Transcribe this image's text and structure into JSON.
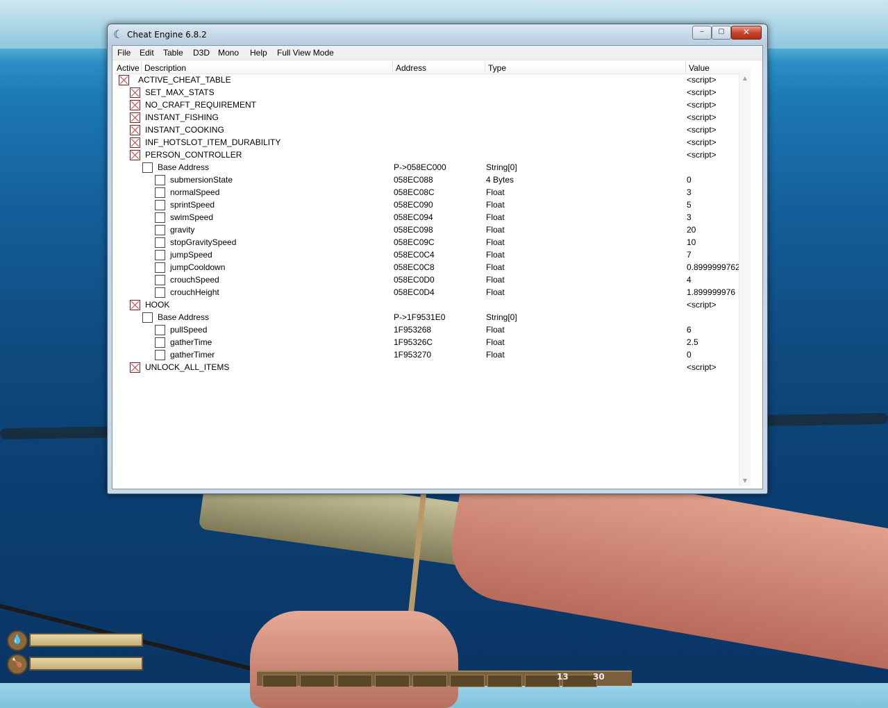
{
  "window": {
    "title": "Cheat Engine 6.8.2",
    "controls": {
      "minimize": "‒",
      "maximize": "▢",
      "close": "✕"
    }
  },
  "menu": [
    "File",
    "Edit",
    "Table",
    "D3D",
    "Mono",
    "Help",
    "Full View Mode"
  ],
  "columns": {
    "active": "Active",
    "description": "Description",
    "address": "Address",
    "type": "Type",
    "value": "Value"
  },
  "rows": [
    {
      "level": 0,
      "checked": true,
      "description": "ACTIVE_CHEAT_TABLE",
      "address": "",
      "type": "",
      "value": "<script>"
    },
    {
      "level": 1,
      "checked": true,
      "description": "SET_MAX_STATS",
      "address": "",
      "type": "",
      "value": "<script>"
    },
    {
      "level": 1,
      "checked": true,
      "description": "NO_CRAFT_REQUIREMENT",
      "address": "",
      "type": "",
      "value": "<script>"
    },
    {
      "level": 1,
      "checked": true,
      "description": "INSTANT_FISHING",
      "address": "",
      "type": "",
      "value": "<script>"
    },
    {
      "level": 1,
      "checked": true,
      "description": "INSTANT_COOKING",
      "address": "",
      "type": "",
      "value": "<script>"
    },
    {
      "level": 1,
      "checked": true,
      "description": "INF_HOTSLOT_ITEM_DURABILITY",
      "address": "",
      "type": "",
      "value": "<script>"
    },
    {
      "level": 1,
      "checked": true,
      "description": "PERSON_CONTROLLER",
      "address": "",
      "type": "",
      "value": "<script>"
    },
    {
      "level": 2,
      "checked": false,
      "description": "Base Address",
      "address": "P->058EC000",
      "type": "String[0]",
      "value": ""
    },
    {
      "level": 3,
      "checked": false,
      "description": "submersionState",
      "address": "058EC088",
      "type": "4 Bytes",
      "value": "0"
    },
    {
      "level": 3,
      "checked": false,
      "description": "normalSpeed",
      "address": "058EC08C",
      "type": "Float",
      "value": "3"
    },
    {
      "level": 3,
      "checked": false,
      "description": "sprintSpeed",
      "address": "058EC090",
      "type": "Float",
      "value": "5"
    },
    {
      "level": 3,
      "checked": false,
      "description": "swimSpeed",
      "address": "058EC094",
      "type": "Float",
      "value": "3"
    },
    {
      "level": 3,
      "checked": false,
      "description": "gravity",
      "address": "058EC098",
      "type": "Float",
      "value": "20"
    },
    {
      "level": 3,
      "checked": false,
      "description": "stopGravitySpeed",
      "address": "058EC09C",
      "type": "Float",
      "value": "10"
    },
    {
      "level": 3,
      "checked": false,
      "description": "jumpSpeed",
      "address": "058EC0C4",
      "type": "Float",
      "value": "7"
    },
    {
      "level": 3,
      "checked": false,
      "description": "jumpCooldown",
      "address": "058EC0C8",
      "type": "Float",
      "value": "0.8999999762"
    },
    {
      "level": 3,
      "checked": false,
      "description": "crouchSpeed",
      "address": "058EC0D0",
      "type": "Float",
      "value": "4"
    },
    {
      "level": 3,
      "checked": false,
      "description": "crouchHeight",
      "address": "058EC0D4",
      "type": "Float",
      "value": "1.899999976"
    },
    {
      "level": 1,
      "checked": true,
      "description": "HOOK",
      "address": "",
      "type": "",
      "value": "<script>"
    },
    {
      "level": 2,
      "checked": false,
      "description": "Base Address",
      "address": "P->1F9531E0",
      "type": "String[0]",
      "value": ""
    },
    {
      "level": 3,
      "checked": false,
      "description": "pullSpeed",
      "address": "1F953268",
      "type": "Float",
      "value": "6"
    },
    {
      "level": 3,
      "checked": false,
      "description": "gatherTime",
      "address": "1F95326C",
      "type": "Float",
      "value": "2.5"
    },
    {
      "level": 3,
      "checked": false,
      "description": "gatherTimer",
      "address": "1F953270",
      "type": "Float",
      "value": "0"
    },
    {
      "level": 1,
      "checked": true,
      "description": "UNLOCK_ALL_ITEMS",
      "address": "",
      "type": "",
      "value": "<script>"
    }
  ],
  "hud": {
    "icons": [
      "water-drop-icon",
      "food-icon"
    ],
    "hotbar_counts": [
      "13",
      "30"
    ]
  }
}
